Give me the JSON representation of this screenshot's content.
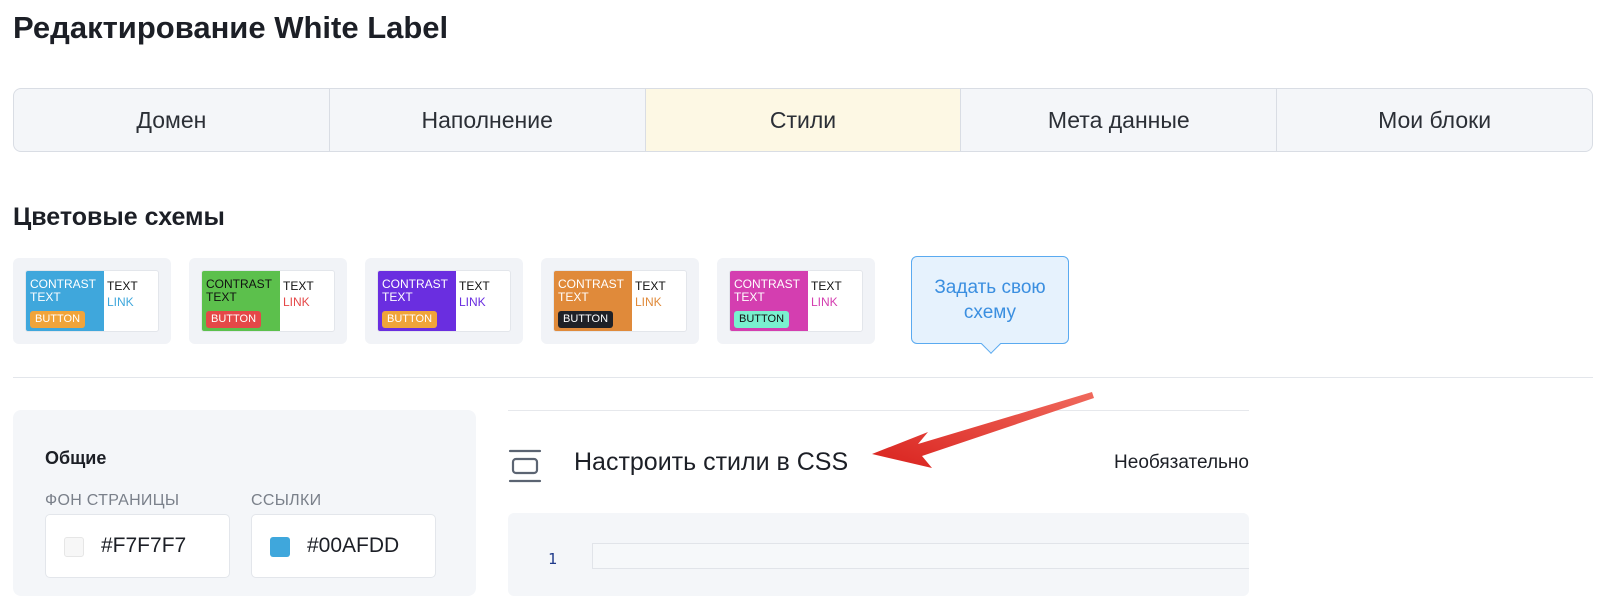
{
  "page": {
    "title": "Редактирование White Label"
  },
  "tabs": [
    {
      "label": "Домен",
      "active": false
    },
    {
      "label": "Наполнение",
      "active": false
    },
    {
      "label": "Стили",
      "active": true
    },
    {
      "label": "Мета данные",
      "active": false
    },
    {
      "label": "Мои блоки",
      "active": false
    }
  ],
  "color_schemes": {
    "title": "Цветовые схемы",
    "items": [
      {
        "contrast_text": "CONTRAST\nTEXT",
        "button": "BUTTON",
        "text": "TEXT",
        "link": "LINK",
        "colors": {
          "bg": "#3fa7dc",
          "contrast": "#ffffff",
          "button_bg": "#f0a43a",
          "button_text": "#ffffff",
          "link": "#3fa7dc"
        }
      },
      {
        "contrast_text": "CONTRAST\nTEXT",
        "button": "BUTTON",
        "text": "TEXT",
        "link": "LINK",
        "colors": {
          "bg": "#5cc04c",
          "contrast": "#111111",
          "button_bg": "#e54848",
          "button_text": "#ffffff",
          "link": "#e54848"
        }
      },
      {
        "contrast_text": "CONTRAST\nTEXT",
        "button": "BUTTON",
        "text": "TEXT",
        "link": "LINK",
        "colors": {
          "bg": "#6a2ee0",
          "contrast": "#ffffff",
          "button_bg": "#f0a43a",
          "button_text": "#ffffff",
          "link": "#6a2ee0"
        }
      },
      {
        "contrast_text": "CONTRAST\nTEXT",
        "button": "BUTTON",
        "text": "TEXT",
        "link": "LINK",
        "colors": {
          "bg": "#e08a3a",
          "contrast": "#ffffff",
          "button_bg": "#1f2127",
          "button_text": "#ffffff",
          "link": "#e08a3a"
        }
      },
      {
        "contrast_text": "CONTRAST\nTEXT",
        "button": "BUTTON",
        "text": "TEXT",
        "link": "LINK",
        "colors": {
          "bg": "#d43eb0",
          "contrast": "#ffffff",
          "button_bg": "#79f0cf",
          "button_text": "#111111",
          "link": "#d43eb0"
        }
      }
    ],
    "custom_label": "Задать свою\nсхему"
  },
  "general": {
    "heading": "Общие",
    "fields": [
      {
        "label": "ФОН СТРАНИЦЫ",
        "value": "#F7F7F7",
        "swatch": "#F7F7F7"
      },
      {
        "label": "ССЫЛКИ",
        "value": "#00AFDD",
        "swatch": "#3fa7dc"
      }
    ]
  },
  "css_editor": {
    "title": "Настроить стили в CSS",
    "optional_label": "Необязательно",
    "line_number": "1",
    "icon": "panel-layout-icon"
  },
  "annotation": {
    "icon": "red-arrow-icon",
    "color": "#e8322f"
  }
}
